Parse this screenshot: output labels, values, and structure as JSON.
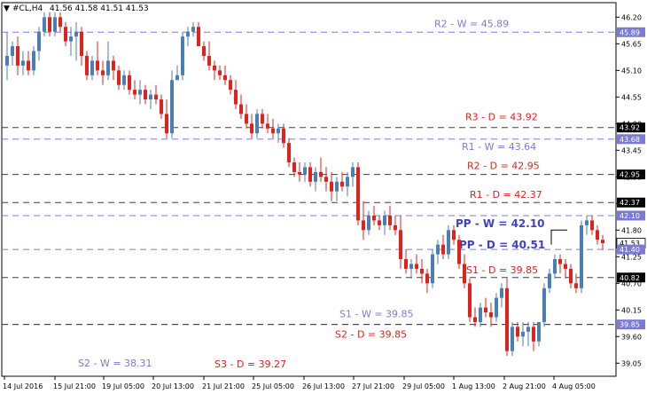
{
  "header": {
    "symbol": "#CL,H4",
    "ohlc": "41.56 41.58 41.51 41.53"
  },
  "colors": {
    "bull": "#4a7fb5",
    "bear": "#e3201b",
    "weekly_level": "#7b7bd6",
    "weekly_pp": "#4040c8",
    "daily_level": "#404040",
    "daily_text": "#e3201b",
    "current_price_bg": "#000000"
  },
  "chart_data": {
    "type": "candlestick",
    "ylim": [
      38.78,
      46.5
    ],
    "y_ticks": [
      "46.20",
      "45.65",
      "45.10",
      "44.55",
      "44.00",
      "43.45",
      "42.90",
      "42.35",
      "41.80",
      "41.25",
      "40.70",
      "40.15",
      "39.60",
      "39.05"
    ],
    "x_ticks": [
      "14 Jul 2016",
      "15 Jul 21:00",
      "19 Jul 05:00",
      "20 Jul 13:00",
      "21 Jul 21:00",
      "25 Jul 05:00",
      "26 Jul 13:00",
      "27 Jul 21:00",
      "29 Jul 05:00",
      "1 Aug 13:00",
      "2 Aug 21:00",
      "4 Aug 05:00"
    ],
    "price_badges": [
      "45.89",
      "43.92",
      "43.68",
      "42.95",
      "42.37",
      "42.10",
      "41.53",
      "41.40",
      "40.82",
      "39.85"
    ],
    "current_price": "41.53",
    "levels": [
      {
        "price": 45.89,
        "text": "R2 - W = 45.89",
        "kind": "weekly"
      },
      {
        "price": 43.92,
        "text": "R3 - D = 43.92",
        "kind": "daily"
      },
      {
        "price": 43.68,
        "text": "R1 - W = 43.64",
        "kind": "weekly"
      },
      {
        "price": 42.95,
        "text": "R2 - D = 42.95",
        "kind": "daily"
      },
      {
        "price": 42.37,
        "text": "R1 - D = 42.37",
        "kind": "daily"
      },
      {
        "price": 42.1,
        "text": "PP - W = 42.10",
        "kind": "weekly_pp"
      },
      {
        "price": 41.4,
        "text": "PP - D = 40.51",
        "kind": "weekly_pp"
      },
      {
        "price": 40.82,
        "text": "S1 - D = 39.85",
        "kind": "daily"
      },
      {
        "price": 39.85,
        "text": "S1 - W = 39.85",
        "kind": "weekly"
      },
      {
        "price": 39.85,
        "text": "S2 - D = 39.85",
        "kind": "daily"
      },
      {
        "price": null,
        "text": "S2 - W = 38.31",
        "kind": "weekly"
      },
      {
        "price": null,
        "text": "S3 - D = 39.27",
        "kind": "daily"
      }
    ],
    "candles": [
      [
        45.2,
        45.9,
        44.9,
        45.4
      ],
      [
        45.4,
        45.7,
        45.2,
        45.6
      ],
      [
        45.6,
        45.8,
        45.0,
        45.2
      ],
      [
        45.2,
        45.5,
        45.0,
        45.3
      ],
      [
        45.3,
        45.5,
        45.0,
        45.1
      ],
      [
        45.1,
        45.6,
        45.0,
        45.5
      ],
      [
        45.5,
        46.0,
        45.3,
        45.9
      ],
      [
        45.9,
        46.3,
        45.8,
        46.2
      ],
      [
        46.2,
        46.3,
        45.8,
        45.9
      ],
      [
        45.9,
        46.3,
        45.8,
        46.2
      ],
      [
        46.2,
        46.3,
        45.9,
        46.0
      ],
      [
        46.0,
        46.1,
        45.6,
        45.7
      ],
      [
        45.7,
        46.0,
        45.4,
        45.8
      ],
      [
        45.8,
        46.1,
        45.3,
        45.9
      ],
      [
        45.9,
        46.0,
        45.2,
        45.4
      ],
      [
        45.4,
        45.5,
        44.9,
        45.0
      ],
      [
        45.0,
        45.4,
        44.9,
        45.3
      ],
      [
        45.3,
        45.7,
        45.0,
        45.1
      ],
      [
        45.1,
        45.3,
        44.8,
        45.0
      ],
      [
        45.0,
        45.7,
        44.9,
        45.3
      ],
      [
        45.3,
        45.4,
        44.9,
        45.1
      ],
      [
        45.1,
        45.2,
        44.7,
        44.8
      ],
      [
        44.8,
        45.1,
        44.7,
        45.0
      ],
      [
        45.0,
        45.1,
        44.6,
        44.7
      ],
      [
        44.7,
        44.9,
        44.5,
        44.6
      ],
      [
        44.6,
        44.9,
        44.4,
        44.7
      ],
      [
        44.7,
        44.8,
        44.4,
        44.5
      ],
      [
        44.5,
        44.7,
        44.3,
        44.6
      ],
      [
        44.6,
        44.8,
        44.4,
        44.5
      ],
      [
        44.5,
        44.6,
        44.1,
        44.2
      ],
      [
        44.2,
        44.5,
        43.7,
        43.8
      ],
      [
        43.8,
        45.1,
        43.7,
        44.9
      ],
      [
        44.9,
        45.2,
        44.9,
        45.0
      ],
      [
        45.0,
        45.9,
        44.9,
        45.8
      ],
      [
        45.8,
        46.0,
        45.6,
        45.9
      ],
      [
        45.9,
        46.1,
        45.8,
        46.0
      ],
      [
        46.0,
        46.1,
        45.6,
        45.6
      ],
      [
        45.6,
        45.7,
        45.3,
        45.4
      ],
      [
        45.4,
        45.7,
        45.1,
        45.2
      ],
      [
        45.2,
        45.3,
        44.9,
        45.1
      ],
      [
        45.1,
        45.2,
        44.9,
        45.0
      ],
      [
        45.0,
        45.2,
        44.8,
        44.9
      ],
      [
        44.9,
        45.0,
        44.6,
        44.7
      ],
      [
        44.7,
        44.9,
        44.3,
        44.4
      ],
      [
        44.4,
        44.6,
        44.1,
        44.2
      ],
      [
        44.2,
        44.4,
        43.9,
        44.0
      ],
      [
        44.0,
        44.2,
        43.7,
        43.8
      ],
      [
        43.8,
        44.3,
        43.7,
        44.2
      ],
      [
        44.2,
        44.3,
        43.9,
        44.0
      ],
      [
        44.0,
        44.2,
        43.8,
        43.9
      ],
      [
        43.9,
        44.1,
        43.7,
        43.8
      ],
      [
        43.8,
        44.0,
        43.6,
        43.9
      ],
      [
        43.9,
        44.0,
        43.5,
        43.6
      ],
      [
        43.6,
        43.7,
        43.1,
        43.2
      ],
      [
        43.2,
        43.3,
        42.9,
        43.0
      ],
      [
        43.0,
        43.2,
        42.8,
        42.95
      ],
      [
        42.95,
        43.2,
        42.8,
        43.1
      ],
      [
        43.1,
        43.2,
        42.7,
        42.8
      ],
      [
        42.8,
        43.1,
        42.6,
        43.0
      ],
      [
        43.0,
        43.3,
        42.8,
        42.9
      ],
      [
        42.9,
        43.1,
        42.6,
        42.8
      ],
      [
        42.8,
        43.0,
        42.4,
        42.6
      ],
      [
        42.6,
        42.9,
        42.4,
        42.8
      ],
      [
        42.8,
        43.0,
        42.6,
        42.7
      ],
      [
        42.7,
        43.0,
        42.5,
        42.9
      ],
      [
        42.9,
        43.2,
        42.7,
        43.1
      ],
      [
        43.1,
        43.2,
        41.9,
        42.0
      ],
      [
        42.0,
        42.4,
        41.6,
        41.8
      ],
      [
        41.8,
        42.2,
        41.7,
        42.1
      ],
      [
        42.1,
        42.3,
        41.9,
        42.0
      ],
      [
        42.0,
        42.1,
        41.8,
        41.9
      ],
      [
        41.9,
        42.2,
        41.7,
        42.1
      ],
      [
        42.1,
        42.3,
        41.8,
        41.9
      ],
      [
        41.9,
        42.1,
        41.7,
        41.8
      ],
      [
        41.8,
        42.1,
        41.0,
        41.2
      ],
      [
        41.2,
        41.4,
        40.9,
        41.0
      ],
      [
        41.0,
        41.2,
        40.8,
        41.1
      ],
      [
        41.1,
        41.3,
        40.9,
        41.0
      ],
      [
        41.0,
        41.2,
        40.7,
        40.9
      ],
      [
        40.9,
        41.0,
        40.5,
        40.7
      ],
      [
        40.7,
        41.4,
        40.6,
        41.3
      ],
      [
        41.3,
        41.6,
        41.1,
        41.5
      ],
      [
        41.5,
        41.7,
        41.2,
        41.3
      ],
      [
        41.3,
        41.9,
        41.2,
        41.8
      ],
      [
        41.8,
        41.9,
        41.5,
        41.6
      ],
      [
        41.6,
        41.7,
        41.0,
        41.1
      ],
      [
        41.1,
        41.3,
        40.6,
        40.7
      ],
      [
        40.7,
        40.8,
        39.9,
        40.0
      ],
      [
        40.0,
        40.2,
        39.8,
        39.9
      ],
      [
        39.9,
        40.3,
        39.8,
        40.2
      ],
      [
        40.2,
        40.4,
        40.0,
        40.1
      ],
      [
        40.1,
        40.3,
        39.8,
        40.0
      ],
      [
        40.0,
        40.5,
        39.9,
        40.4
      ],
      [
        40.4,
        40.7,
        40.2,
        40.6
      ],
      [
        40.6,
        40.8,
        39.2,
        39.3
      ],
      [
        39.3,
        39.9,
        39.2,
        39.8
      ],
      [
        39.8,
        39.9,
        39.5,
        39.6
      ],
      [
        39.6,
        39.9,
        39.4,
        39.7
      ],
      [
        39.7,
        39.9,
        39.4,
        39.8
      ],
      [
        39.8,
        39.9,
        39.3,
        39.5
      ],
      [
        39.5,
        39.8,
        39.4,
        39.9
      ],
      [
        39.9,
        40.7,
        39.8,
        40.6
      ],
      [
        40.6,
        41.0,
        40.5,
        40.9
      ],
      [
        40.9,
        41.3,
        40.8,
        41.2
      ],
      [
        41.2,
        41.3,
        40.9,
        41.1
      ],
      [
        41.1,
        41.2,
        40.8,
        41.0
      ],
      [
        41.0,
        41.1,
        40.6,
        40.7
      ],
      [
        40.7,
        40.9,
        40.5,
        40.6
      ],
      [
        40.6,
        42.0,
        40.5,
        41.9
      ],
      [
        41.9,
        42.1,
        41.7,
        42.0
      ],
      [
        42.0,
        42.1,
        41.7,
        41.8
      ],
      [
        41.8,
        41.9,
        41.5,
        41.6
      ],
      [
        41.6,
        41.7,
        41.4,
        41.53
      ]
    ]
  }
}
